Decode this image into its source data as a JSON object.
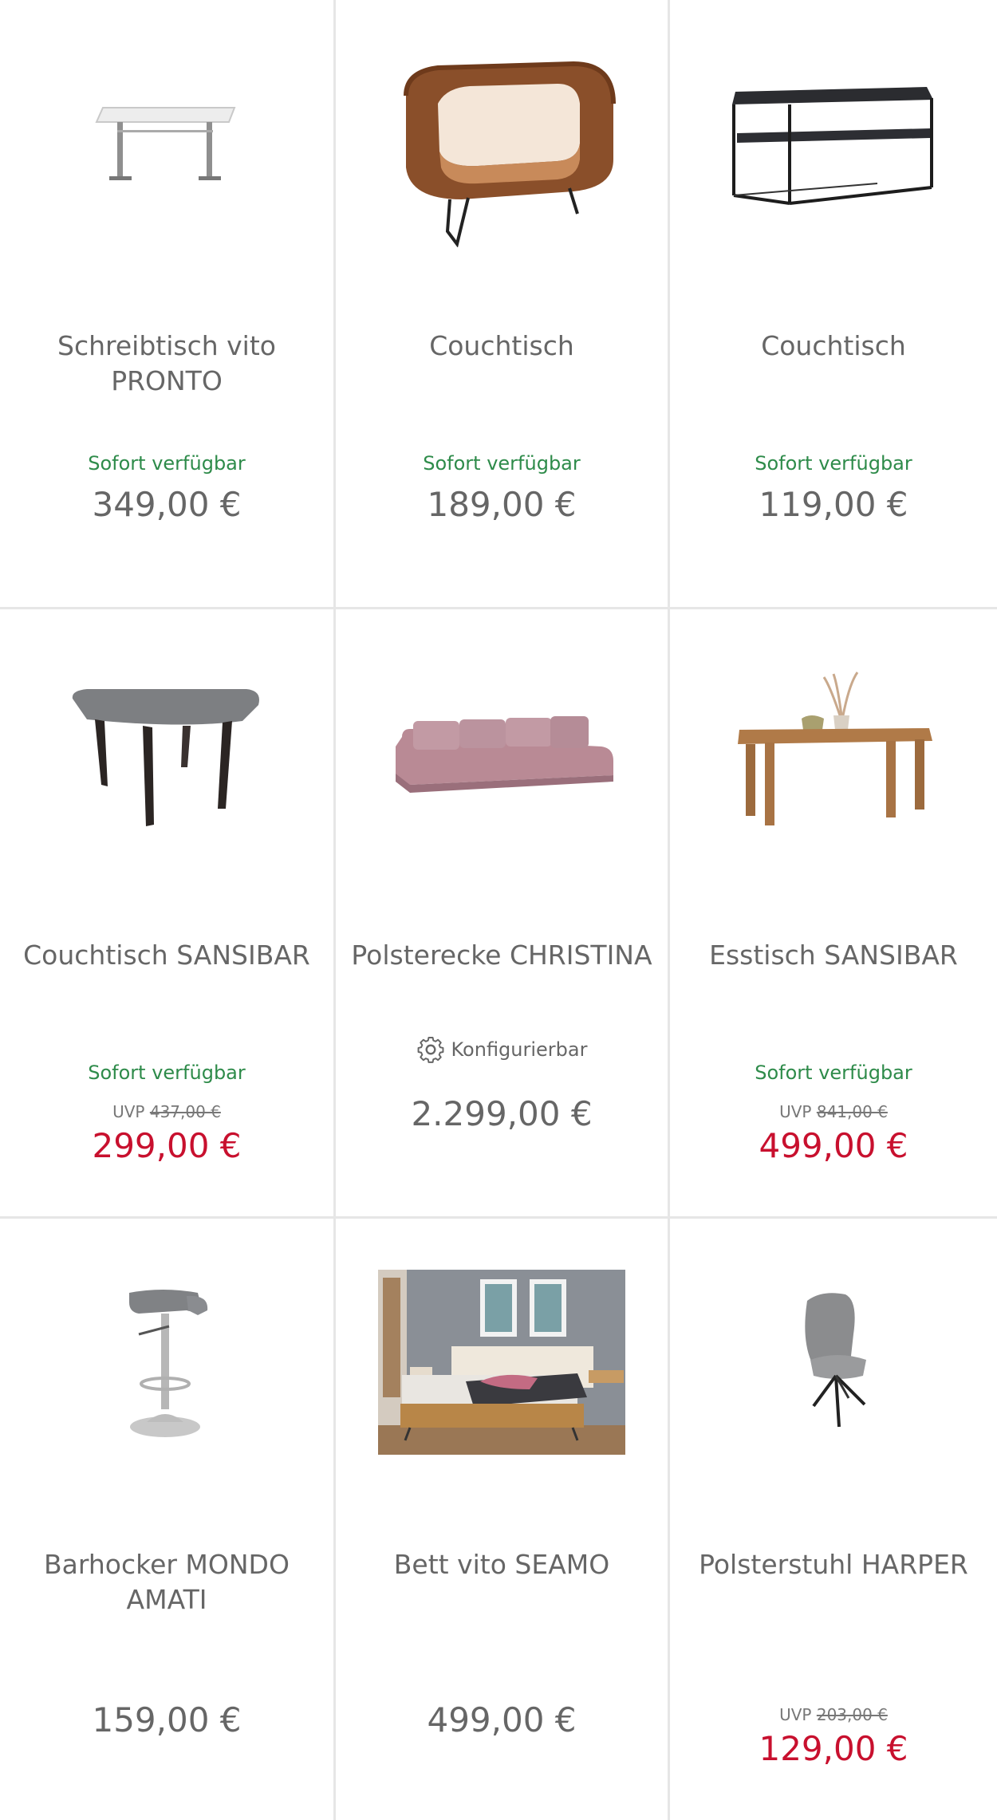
{
  "products": [
    {
      "name": "Schreibtisch vito PRONTO",
      "availability": "Sofort verfügbar",
      "price": "349,00 €",
      "uvp_label": "",
      "uvp_value": "",
      "config": "",
      "image_icon": "desk-icon"
    },
    {
      "name": "Couchtisch",
      "availability": "Sofort verfügbar",
      "price": "189,00 €",
      "uvp_label": "",
      "uvp_value": "",
      "config": "",
      "image_icon": "wood-coffee-table-icon"
    },
    {
      "name": "Couchtisch",
      "availability": "Sofort verfügbar",
      "price": "119,00 €",
      "uvp_label": "",
      "uvp_value": "",
      "config": "",
      "image_icon": "metal-coffee-table-icon"
    },
    {
      "name": "Couchtisch SANSIBAR",
      "availability": "Sofort verfügbar",
      "price": "299,00 €",
      "uvp_label": "UVP",
      "uvp_value": "437,00 €",
      "config": "",
      "image_icon": "grey-table-icon"
    },
    {
      "name": "Polsterecke CHRISTINA",
      "availability": "",
      "price": "2.299,00 €",
      "uvp_label": "",
      "uvp_value": "",
      "config": "Konfigurierbar",
      "image_icon": "sofa-icon"
    },
    {
      "name": "Esstisch SANSIBAR",
      "availability": "Sofort verfügbar",
      "price": "499,00 €",
      "uvp_label": "UVP",
      "uvp_value": "841,00 €",
      "config": "",
      "image_icon": "dining-table-icon"
    },
    {
      "name": "Barhocker MONDO AMATI",
      "availability": "",
      "price": "159,00 €",
      "uvp_label": "",
      "uvp_value": "",
      "config": "",
      "image_icon": "bar-stool-icon"
    },
    {
      "name": "Bett vito SEAMO",
      "availability": "",
      "price": "499,00 €",
      "uvp_label": "",
      "uvp_value": "",
      "config": "",
      "image_icon": "bed-photo-icon"
    },
    {
      "name": "Polsterstuhl HARPER",
      "availability": "",
      "price": "129,00 €",
      "uvp_label": "UVP",
      "uvp_value": "203,00 €",
      "config": "",
      "image_icon": "chair-icon"
    }
  ],
  "colors": {
    "available": "#2e8b4a",
    "sale": "#c8102e",
    "text": "#666666",
    "divider": "#e6e6e6"
  }
}
